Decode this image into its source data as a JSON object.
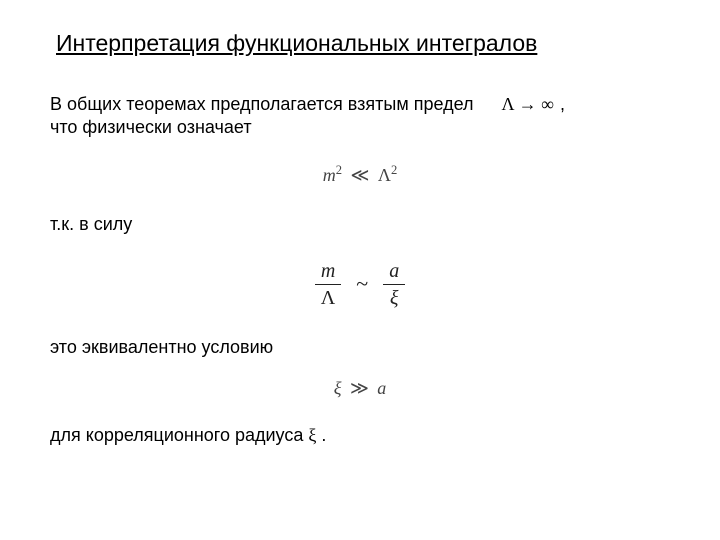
{
  "title": "Интерпретация функциональных интегралов",
  "line1": "В общих теоремах предполагается взятым предел",
  "limit_expr": "Λ → ∞",
  "comma": ",",
  "line2": "что физически означает",
  "formula1_lhs_base": "m",
  "formula1_lhs_exp": "2",
  "formula1_rel": "≪",
  "formula1_rhs_base": "Λ",
  "formula1_rhs_exp": "2",
  "line3": "т.к. в силу",
  "ratio_left_num": "m",
  "ratio_left_den": "Λ",
  "ratio_rel": "~",
  "ratio_right_num": "a",
  "ratio_right_den": "ξ",
  "line4": "это эквивалентно условию",
  "formula3_lhs": "ξ",
  "formula3_rel": "≫",
  "formula3_rhs": "a",
  "line5_pre": "для корреляционного радиуса  ",
  "line5_sym": "ξ",
  "line5_post": " ."
}
